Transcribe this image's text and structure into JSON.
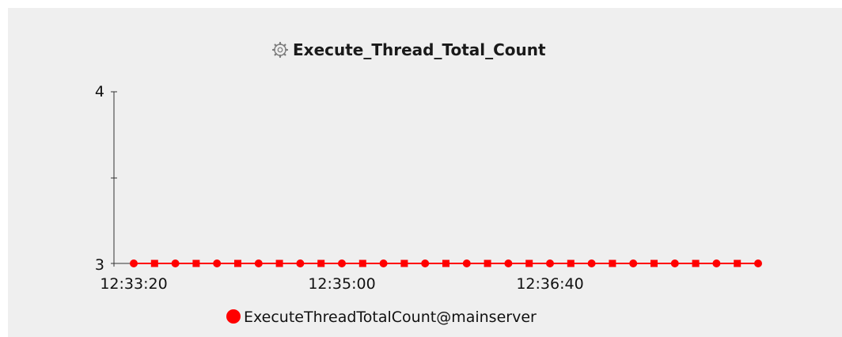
{
  "chart_data": {
    "type": "line",
    "title": "Execute_Thread_Total_Count",
    "title_icon": "gear-icon",
    "xlabel": "",
    "ylabel": "",
    "x_ticks": [
      "12:33:20",
      "12:35:00",
      "12:36:40"
    ],
    "y_ticks": [
      3,
      4
    ],
    "ylim": [
      3,
      4
    ],
    "xlim": [
      "12:33:20",
      "12:38:23"
    ],
    "grid": false,
    "legend_position": "bottom-center",
    "series": [
      {
        "name": "ExecuteThreadTotalCount@mainserver",
        "color": "#ff0000",
        "x": [
          "12:33:20",
          "12:33:30",
          "12:33:40",
          "12:33:50",
          "12:34:00",
          "12:34:10",
          "12:34:20",
          "12:34:30",
          "12:34:40",
          "12:34:50",
          "12:35:00",
          "12:35:10",
          "12:35:20",
          "12:35:30",
          "12:35:40",
          "12:35:50",
          "12:36:00",
          "12:36:10",
          "12:36:20",
          "12:36:30",
          "12:36:40",
          "12:36:50",
          "12:37:00",
          "12:37:10",
          "12:37:20",
          "12:37:30",
          "12:37:40",
          "12:37:50",
          "12:38:00",
          "12:38:10",
          "12:38:20"
        ],
        "values": [
          3,
          3,
          3,
          3,
          3,
          3,
          3,
          3,
          3,
          3,
          3,
          3,
          3,
          3,
          3,
          3,
          3,
          3,
          3,
          3,
          3,
          3,
          3,
          3,
          3,
          3,
          3,
          3,
          3,
          3,
          3
        ]
      }
    ]
  },
  "colors": {
    "background": "#efefef",
    "axis": "#333333",
    "series": "#ff0000"
  }
}
